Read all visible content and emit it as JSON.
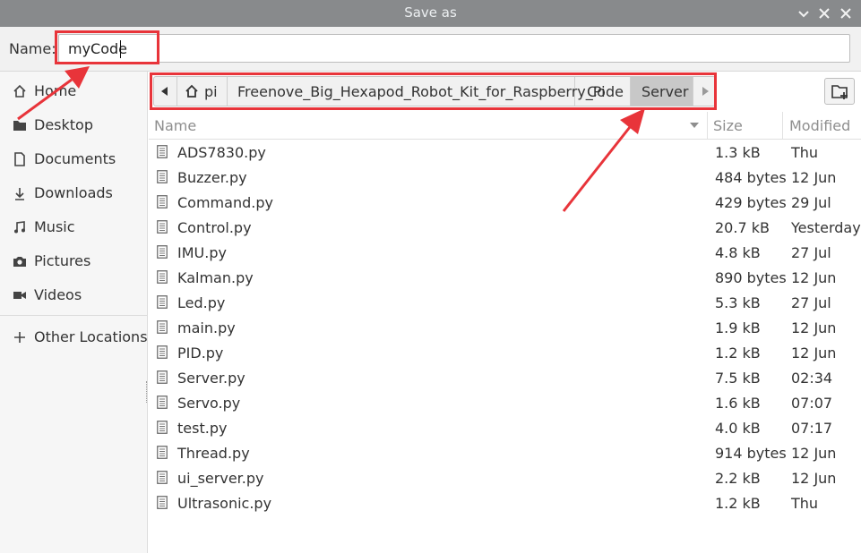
{
  "window": {
    "title": "Save as"
  },
  "name_field": {
    "label": "Name:",
    "value": "myCode"
  },
  "sidebar": {
    "items": [
      {
        "label": "Home",
        "icon": "home-icon"
      },
      {
        "label": "Desktop",
        "icon": "folder-icon"
      },
      {
        "label": "Documents",
        "icon": "document-icon"
      },
      {
        "label": "Downloads",
        "icon": "download-icon"
      },
      {
        "label": "Music",
        "icon": "music-icon"
      },
      {
        "label": "Pictures",
        "icon": "camera-icon"
      },
      {
        "label": "Videos",
        "icon": "video-icon"
      }
    ],
    "other_locations": {
      "label": "Other Locations",
      "icon": "plus-icon"
    }
  },
  "pathbar": {
    "crumbs": [
      "pi",
      "Freenove_Big_Hexapod_Robot_Kit_for_Raspberry_Pi",
      "Code",
      "Server"
    ],
    "active_index": 3
  },
  "file_list": {
    "columns": [
      "Name",
      "Size",
      "Modified"
    ],
    "rows": [
      {
        "name": "ADS7830.py",
        "size": "1.3 kB",
        "modified": "Thu"
      },
      {
        "name": "Buzzer.py",
        "size": "484 bytes",
        "modified": "12 Jun"
      },
      {
        "name": "Command.py",
        "size": "429 bytes",
        "modified": "29 Jul"
      },
      {
        "name": "Control.py",
        "size": "20.7 kB",
        "modified": "Yesterday"
      },
      {
        "name": "IMU.py",
        "size": "4.8 kB",
        "modified": "27 Jul"
      },
      {
        "name": "Kalman.py",
        "size": "890 bytes",
        "modified": "12 Jun"
      },
      {
        "name": "Led.py",
        "size": "5.3 kB",
        "modified": "27 Jul"
      },
      {
        "name": "main.py",
        "size": "1.9 kB",
        "modified": "12 Jun"
      },
      {
        "name": "PID.py",
        "size": "1.2 kB",
        "modified": "12 Jun"
      },
      {
        "name": "Server.py",
        "size": "7.5 kB",
        "modified": "02:34"
      },
      {
        "name": "Servo.py",
        "size": "1.6 kB",
        "modified": "07:07"
      },
      {
        "name": "test.py",
        "size": "4.0 kB",
        "modified": "07:17"
      },
      {
        "name": "Thread.py",
        "size": "914 bytes",
        "modified": "12 Jun"
      },
      {
        "name": "ui_server.py",
        "size": "2.2 kB",
        "modified": "12 Jun"
      },
      {
        "name": "Ultrasonic.py",
        "size": "1.2 kB",
        "modified": "Thu"
      }
    ]
  },
  "colors": {
    "titlebar": "#888a8c",
    "annotation": "#e8343a",
    "active_crumb": "#c8c8c8"
  }
}
